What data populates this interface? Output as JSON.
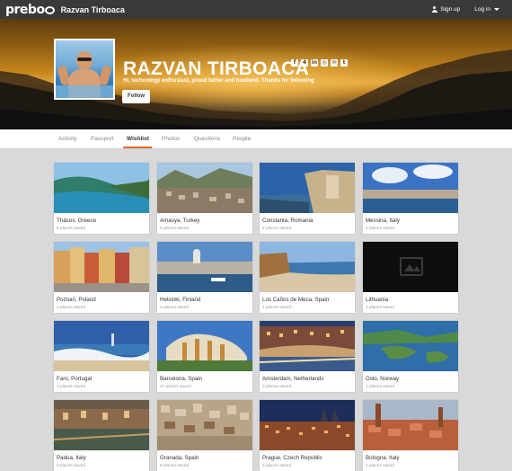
{
  "header": {
    "logo": "prebo",
    "user_name": "Razvan Tirboaca",
    "signup_label": "Sign up",
    "login_label": "Log in"
  },
  "profile": {
    "name": "RAZVAN TIRBOACA",
    "bio": "Hi, technology enthusiast, proud father and husband. Thanks for following",
    "follow_label": "Follow",
    "social_icons": [
      "facebook-icon",
      "foursquare-icon",
      "linkedin-icon",
      "instagram-icon",
      "email-icon",
      "twitter-icon"
    ]
  },
  "tabs": [
    {
      "label": "Activity"
    },
    {
      "label": "Passport"
    },
    {
      "label": "Wishlist",
      "active": true
    },
    {
      "label": "Photos"
    },
    {
      "label": "Questions"
    },
    {
      "label": "People"
    }
  ],
  "cards": [
    {
      "place": "Thásos, Greece",
      "saved": "5 places saved"
    },
    {
      "place": "Amasya, Turkey",
      "saved": "5 places saved"
    },
    {
      "place": "Constanta, Romania",
      "saved": "2 places saved"
    },
    {
      "place": "Messina, Italy",
      "saved": "1 places saved"
    },
    {
      "place": "Poznań, Poland",
      "saved": "1 places saved"
    },
    {
      "place": "Helsinki, Finland",
      "saved": "2 places saved"
    },
    {
      "place": "Los Caños de Meca, Spain",
      "saved": "1 places saved"
    },
    {
      "place": "Lithuania",
      "saved": "1 places saved"
    },
    {
      "place": "Faro, Portugal",
      "saved": "3 places saved"
    },
    {
      "place": "Barcelona, Spain",
      "saved": "27 places saved"
    },
    {
      "place": "Amsterdam, Netherlands",
      "saved": "3 places saved"
    },
    {
      "place": "Oslo, Norway",
      "saved": "1 places saved"
    },
    {
      "place": "Padua, Italy",
      "saved": "3 places saved"
    },
    {
      "place": "Granada, Spain",
      "saved": "8 places saved"
    },
    {
      "place": "Prague, Czech Republic",
      "saved": "3 places saved"
    },
    {
      "place": "Bologna, Italy",
      "saved": "1 places saved"
    }
  ],
  "colors": {
    "topbar": "#3a3a3a",
    "accent": "#e06a2a",
    "page_bg": "#d9d9d9"
  }
}
